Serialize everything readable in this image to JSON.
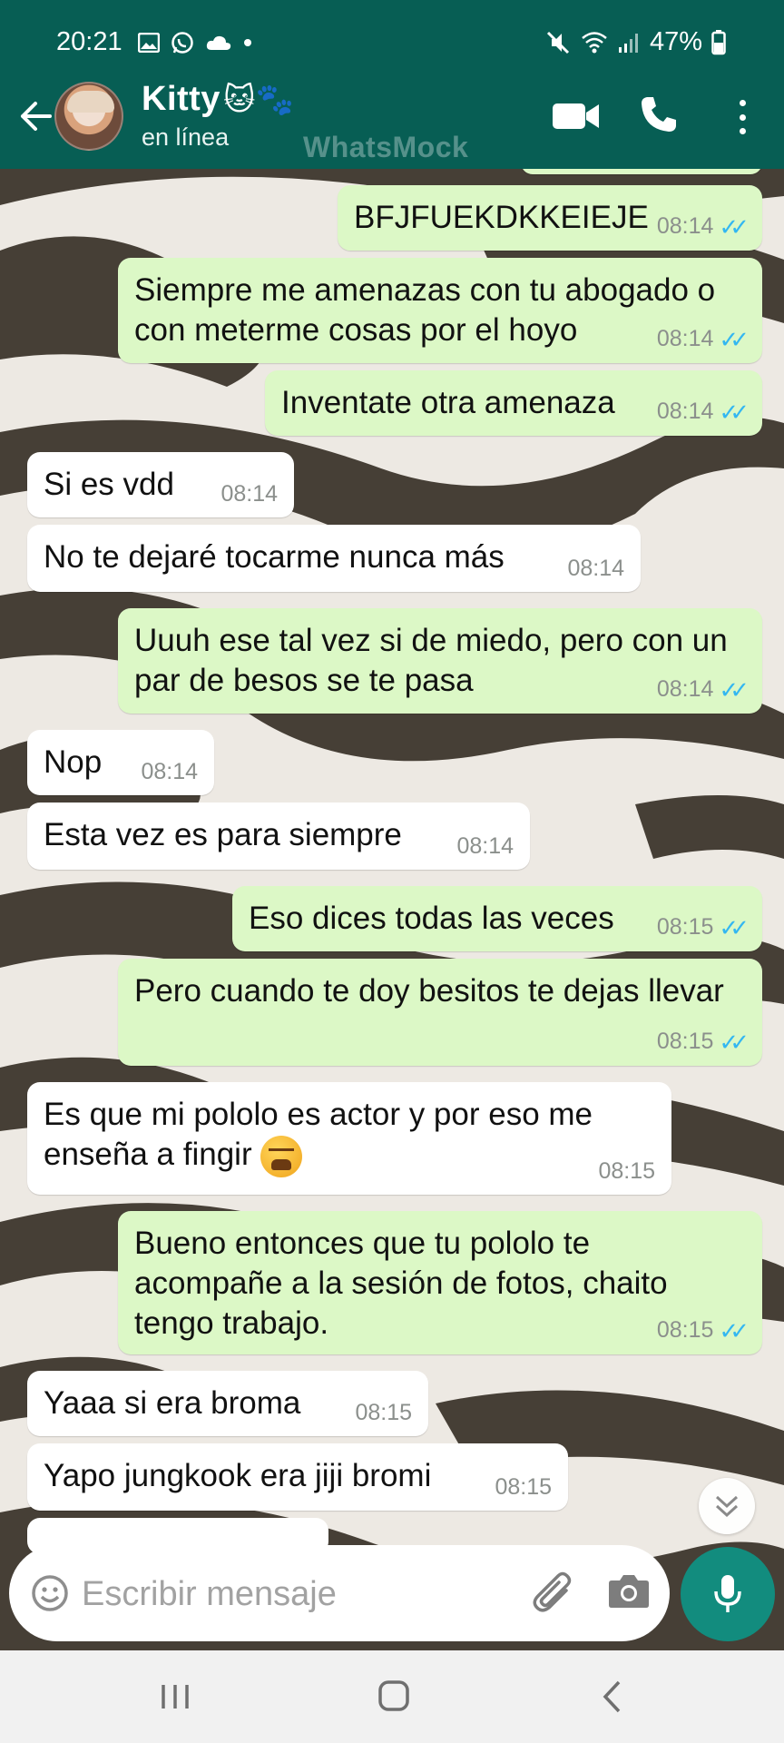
{
  "status_bar": {
    "time": "20:21",
    "battery": "47%"
  },
  "header": {
    "contact_name": "Kitty",
    "contact_emoji": "🐱🐾",
    "contact_status": "en línea",
    "watermark": "WhatsMock",
    "icons": [
      "back-arrow-icon",
      "video-call-icon",
      "phone-icon",
      "more-vert-icon"
    ]
  },
  "messages": [
    {
      "dir": "out",
      "text": "BFJFUEKDKKEIEJE",
      "time": "08:14"
    },
    {
      "dir": "out",
      "text": "Siempre me amenazas con tu abogado o\ncon meterme cosas por el hoyo",
      "time": "08:14"
    },
    {
      "dir": "out",
      "text": "Inventate otra amenaza",
      "time": "08:14"
    },
    {
      "dir": "in",
      "text": "Si es vdd",
      "time": "08:14"
    },
    {
      "dir": "in",
      "text": "No te dejaré tocarme nunca más",
      "time": "08:14"
    },
    {
      "dir": "out",
      "text": "Uuuh ese tal vez si de miedo, pero con un\npar de besos se te pasa",
      "time": "08:14"
    },
    {
      "dir": "in",
      "text": "Nop",
      "time": "08:14"
    },
    {
      "dir": "in",
      "text": "Esta vez es para siempre",
      "time": "08:14"
    },
    {
      "dir": "out",
      "text": "Eso dices todas las veces",
      "time": "08:15"
    },
    {
      "dir": "out",
      "text": "Pero cuando te doy besitos te dejas llevar",
      "time": "08:15"
    },
    {
      "dir": "in",
      "text": "Es que mi pololo es actor y por eso me\nenseña a fingir",
      "time": "08:15"
    },
    {
      "dir": "out",
      "text": "Bueno entonces que tu pololo te\nacompañe a la sesión de fotos, chaito\ntengo trabajo.",
      "time": "08:15"
    },
    {
      "dir": "in",
      "text": "Yaaa si era broma",
      "time": "08:15"
    },
    {
      "dir": "in",
      "text": "Yapo jungkook era jiji bromi",
      "time": "08:15"
    }
  ],
  "input": {
    "placeholder": "Escribir mensaje"
  },
  "colors": {
    "header": "#075e54",
    "outgoing_bubble": "#dcf8c6",
    "incoming_bubble": "#ffffff",
    "read_ticks": "#34b7f1",
    "mic_button": "#128c7e"
  }
}
